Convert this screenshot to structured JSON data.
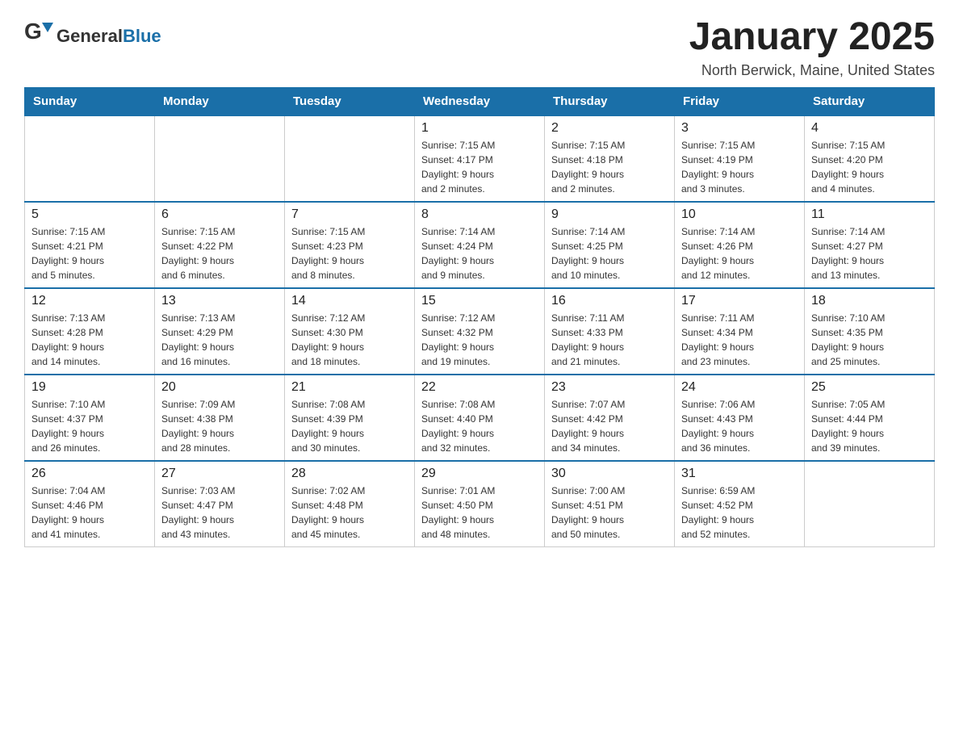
{
  "header": {
    "logo_general": "General",
    "logo_blue": "Blue",
    "title": "January 2025",
    "subtitle": "North Berwick, Maine, United States"
  },
  "weekdays": [
    "Sunday",
    "Monday",
    "Tuesday",
    "Wednesday",
    "Thursday",
    "Friday",
    "Saturday"
  ],
  "weeks": [
    [
      {
        "day": "",
        "info": ""
      },
      {
        "day": "",
        "info": ""
      },
      {
        "day": "",
        "info": ""
      },
      {
        "day": "1",
        "info": "Sunrise: 7:15 AM\nSunset: 4:17 PM\nDaylight: 9 hours\nand 2 minutes."
      },
      {
        "day": "2",
        "info": "Sunrise: 7:15 AM\nSunset: 4:18 PM\nDaylight: 9 hours\nand 2 minutes."
      },
      {
        "day": "3",
        "info": "Sunrise: 7:15 AM\nSunset: 4:19 PM\nDaylight: 9 hours\nand 3 minutes."
      },
      {
        "day": "4",
        "info": "Sunrise: 7:15 AM\nSunset: 4:20 PM\nDaylight: 9 hours\nand 4 minutes."
      }
    ],
    [
      {
        "day": "5",
        "info": "Sunrise: 7:15 AM\nSunset: 4:21 PM\nDaylight: 9 hours\nand 5 minutes."
      },
      {
        "day": "6",
        "info": "Sunrise: 7:15 AM\nSunset: 4:22 PM\nDaylight: 9 hours\nand 6 minutes."
      },
      {
        "day": "7",
        "info": "Sunrise: 7:15 AM\nSunset: 4:23 PM\nDaylight: 9 hours\nand 8 minutes."
      },
      {
        "day": "8",
        "info": "Sunrise: 7:14 AM\nSunset: 4:24 PM\nDaylight: 9 hours\nand 9 minutes."
      },
      {
        "day": "9",
        "info": "Sunrise: 7:14 AM\nSunset: 4:25 PM\nDaylight: 9 hours\nand 10 minutes."
      },
      {
        "day": "10",
        "info": "Sunrise: 7:14 AM\nSunset: 4:26 PM\nDaylight: 9 hours\nand 12 minutes."
      },
      {
        "day": "11",
        "info": "Sunrise: 7:14 AM\nSunset: 4:27 PM\nDaylight: 9 hours\nand 13 minutes."
      }
    ],
    [
      {
        "day": "12",
        "info": "Sunrise: 7:13 AM\nSunset: 4:28 PM\nDaylight: 9 hours\nand 14 minutes."
      },
      {
        "day": "13",
        "info": "Sunrise: 7:13 AM\nSunset: 4:29 PM\nDaylight: 9 hours\nand 16 minutes."
      },
      {
        "day": "14",
        "info": "Sunrise: 7:12 AM\nSunset: 4:30 PM\nDaylight: 9 hours\nand 18 minutes."
      },
      {
        "day": "15",
        "info": "Sunrise: 7:12 AM\nSunset: 4:32 PM\nDaylight: 9 hours\nand 19 minutes."
      },
      {
        "day": "16",
        "info": "Sunrise: 7:11 AM\nSunset: 4:33 PM\nDaylight: 9 hours\nand 21 minutes."
      },
      {
        "day": "17",
        "info": "Sunrise: 7:11 AM\nSunset: 4:34 PM\nDaylight: 9 hours\nand 23 minutes."
      },
      {
        "day": "18",
        "info": "Sunrise: 7:10 AM\nSunset: 4:35 PM\nDaylight: 9 hours\nand 25 minutes."
      }
    ],
    [
      {
        "day": "19",
        "info": "Sunrise: 7:10 AM\nSunset: 4:37 PM\nDaylight: 9 hours\nand 26 minutes."
      },
      {
        "day": "20",
        "info": "Sunrise: 7:09 AM\nSunset: 4:38 PM\nDaylight: 9 hours\nand 28 minutes."
      },
      {
        "day": "21",
        "info": "Sunrise: 7:08 AM\nSunset: 4:39 PM\nDaylight: 9 hours\nand 30 minutes."
      },
      {
        "day": "22",
        "info": "Sunrise: 7:08 AM\nSunset: 4:40 PM\nDaylight: 9 hours\nand 32 minutes."
      },
      {
        "day": "23",
        "info": "Sunrise: 7:07 AM\nSunset: 4:42 PM\nDaylight: 9 hours\nand 34 minutes."
      },
      {
        "day": "24",
        "info": "Sunrise: 7:06 AM\nSunset: 4:43 PM\nDaylight: 9 hours\nand 36 minutes."
      },
      {
        "day": "25",
        "info": "Sunrise: 7:05 AM\nSunset: 4:44 PM\nDaylight: 9 hours\nand 39 minutes."
      }
    ],
    [
      {
        "day": "26",
        "info": "Sunrise: 7:04 AM\nSunset: 4:46 PM\nDaylight: 9 hours\nand 41 minutes."
      },
      {
        "day": "27",
        "info": "Sunrise: 7:03 AM\nSunset: 4:47 PM\nDaylight: 9 hours\nand 43 minutes."
      },
      {
        "day": "28",
        "info": "Sunrise: 7:02 AM\nSunset: 4:48 PM\nDaylight: 9 hours\nand 45 minutes."
      },
      {
        "day": "29",
        "info": "Sunrise: 7:01 AM\nSunset: 4:50 PM\nDaylight: 9 hours\nand 48 minutes."
      },
      {
        "day": "30",
        "info": "Sunrise: 7:00 AM\nSunset: 4:51 PM\nDaylight: 9 hours\nand 50 minutes."
      },
      {
        "day": "31",
        "info": "Sunrise: 6:59 AM\nSunset: 4:52 PM\nDaylight: 9 hours\nand 52 minutes."
      },
      {
        "day": "",
        "info": ""
      }
    ]
  ]
}
